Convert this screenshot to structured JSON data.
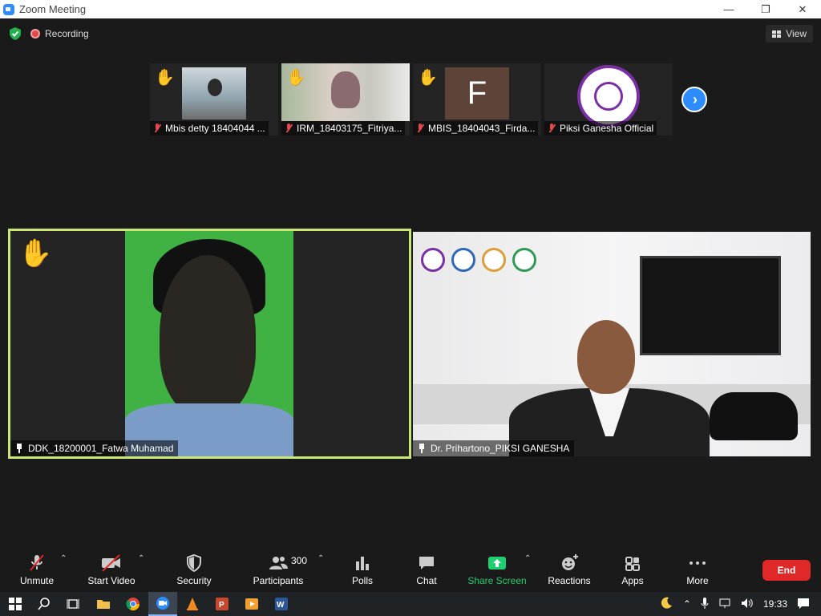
{
  "window": {
    "title": "Zoom Meeting"
  },
  "meeting": {
    "recording_label": "Recording",
    "view_label": "View"
  },
  "thumbnails": [
    {
      "name": "Mbis detty 18404044 ..."
    },
    {
      "name": "IRM_18403175_Fitriya..."
    },
    {
      "name": "MBIS_18404043_Firda...",
      "initial": "F"
    },
    {
      "name": "Piksi Ganesha Official"
    }
  ],
  "videos": {
    "left": {
      "name": "DDK_18200001_Fatwa Muhamad"
    },
    "right": {
      "name": "Dr. Prihartono_PIKSI GANESHA"
    }
  },
  "toolbar": {
    "unmute": "Unmute",
    "start_video": "Start Video",
    "security": "Security",
    "participants": "Participants",
    "participants_count": "300",
    "polls": "Polls",
    "chat": "Chat",
    "share_screen": "Share Screen",
    "reactions": "Reactions",
    "apps": "Apps",
    "more": "More",
    "end": "End"
  },
  "taskbar": {
    "clock": "19:33"
  },
  "colors": {
    "accent": "#2d8cff",
    "active_speaker": "#c9e676",
    "end": "#e02828",
    "share": "#1fce71"
  }
}
